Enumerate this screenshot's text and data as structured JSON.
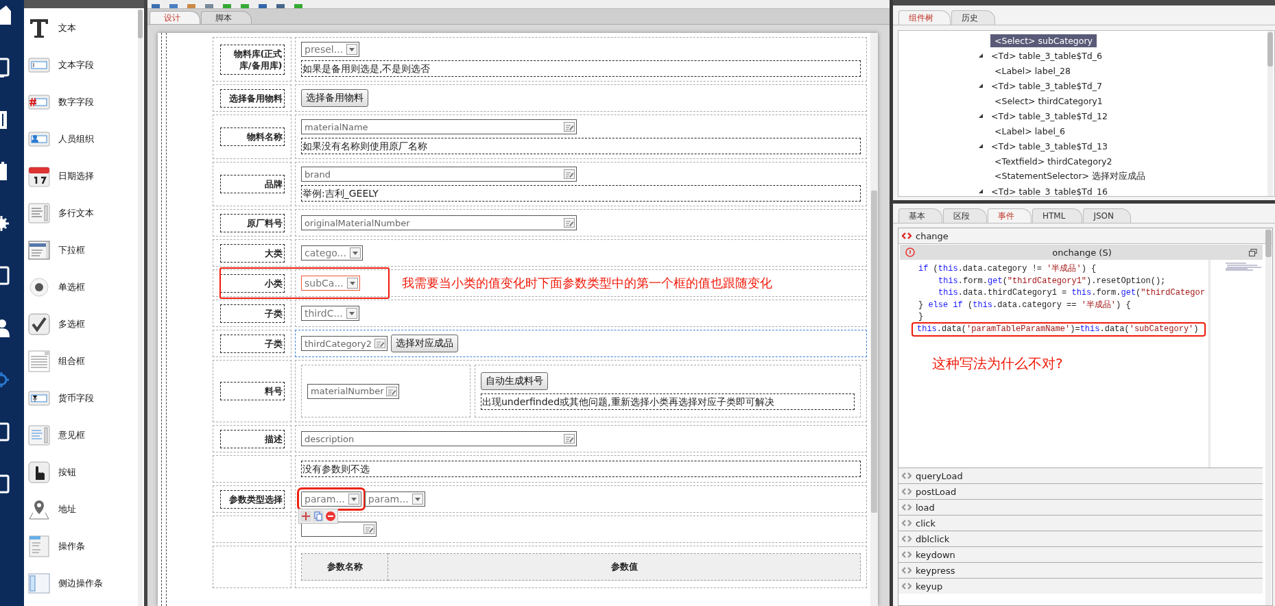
{
  "palette": {
    "items": [
      {
        "label": "文本"
      },
      {
        "label": "文本字段"
      },
      {
        "label": "数字字段"
      },
      {
        "label": "人员组织"
      },
      {
        "label": "日期选择"
      },
      {
        "label": "多行文本"
      },
      {
        "label": "下拉框"
      },
      {
        "label": "单选框"
      },
      {
        "label": "多选框"
      },
      {
        "label": "组合框"
      },
      {
        "label": "货币字段"
      },
      {
        "label": "意见框"
      },
      {
        "label": "按钮"
      },
      {
        "label": "地址"
      },
      {
        "label": "操作条"
      },
      {
        "label": "侧边操作条"
      }
    ]
  },
  "designer": {
    "tabs": [
      {
        "label": "设计",
        "selected": true
      },
      {
        "label": "脚本",
        "selected": false
      }
    ],
    "rows": [
      {
        "label": "物料库(正式库/备用库)",
        "selected": false,
        "highlighted": false,
        "items": [
          {
            "kind": "select",
            "value": "presel...",
            "highlighted": false,
            "framed": false
          },
          {
            "kind": "note",
            "text": "如果是备用则选是,不是则选否"
          }
        ]
      },
      {
        "label": "选择备用物料",
        "selected": false,
        "highlighted": false,
        "items": [
          {
            "kind": "button",
            "label": "选择备用物料"
          }
        ]
      },
      {
        "label": "物料名称",
        "selected": false,
        "highlighted": false,
        "items": [
          {
            "kind": "textfield",
            "value": "materialName",
            "wide": true
          },
          {
            "kind": "note",
            "text": "如果没有名称则使用原厂名称"
          }
        ]
      },
      {
        "label": "品牌",
        "selected": false,
        "highlighted": false,
        "items": [
          {
            "kind": "textfield",
            "value": "brand",
            "wide": true
          },
          {
            "kind": "note",
            "text": "举例:吉利_GEELY"
          }
        ]
      },
      {
        "label": "原厂料号",
        "selected": false,
        "highlighted": false,
        "items": [
          {
            "kind": "textfield",
            "value": "originalMaterialNumber",
            "wide": true
          }
        ]
      },
      {
        "label": "大类",
        "selected": false,
        "highlighted": false,
        "items": [
          {
            "kind": "select",
            "value": "catego...",
            "highlighted": false,
            "framed": false
          }
        ]
      },
      {
        "label": "小类",
        "selected": false,
        "highlighted": true,
        "items": [
          {
            "kind": "select",
            "value": "subCa...",
            "highlighted": true,
            "framed": false
          },
          {
            "kind": "annotation",
            "text": "我需要当小类的值变化时下面参数类型中的第一个框的值也跟随变化"
          }
        ]
      },
      {
        "label": "子类",
        "selected": false,
        "highlighted": false,
        "items": [
          {
            "kind": "select",
            "value": "thirdC...",
            "highlighted": false,
            "framed": false
          }
        ]
      },
      {
        "label": "子类",
        "selected": true,
        "highlighted": false,
        "items": [
          {
            "kind": "textfield",
            "value": "thirdCategory2",
            "wide": false
          },
          {
            "kind": "button",
            "label": "选择对应成品"
          }
        ]
      },
      {
        "label": "料号",
        "selected": false,
        "highlighted": false,
        "items": [
          {
            "kind": "nested",
            "columns": [
              [
                {
                  "kind": "textfield",
                  "value": "materialNumber",
                  "wide": false
                }
              ],
              [
                {
                  "kind": "button",
                  "label": "自动生成料号"
                },
                {
                  "kind": "note",
                  "text": "出现underfinded或其他问题,重新选择小类再选择对应子类即可解决"
                }
              ]
            ]
          }
        ]
      },
      {
        "label": "描述",
        "selected": false,
        "highlighted": false,
        "items": [
          {
            "kind": "textfield",
            "value": "description",
            "wide": true
          }
        ]
      },
      {
        "selected": false,
        "highlighted": false,
        "items": [
          {
            "kind": "note",
            "text": "没有参数则不选"
          }
        ]
      },
      {
        "label": "参数类型选择",
        "selected": false,
        "highlighted": false,
        "items": [
          {
            "kind": "select",
            "value": "param...",
            "highlighted": false,
            "framed": true
          },
          {
            "kind": "select",
            "value": "param...",
            "highlighted": false,
            "framed": false
          }
        ]
      },
      {
        "selected": false,
        "highlighted": false,
        "items": [
          {
            "kind": "textfield",
            "wide": false
          }
        ]
      },
      {
        "selected": false,
        "highlighted": false,
        "items": [
          {
            "kind": "table",
            "columns": [
              "参数名称",
              "参数值"
            ]
          }
        ]
      }
    ]
  },
  "component_tree": {
    "tabs": [
      {
        "label": "组件树",
        "selected": true
      },
      {
        "label": "历史",
        "selected": false
      }
    ],
    "continued_children": [
      {
        "text": "<Select> subCategory",
        "selected": true
      }
    ],
    "items": [
      {
        "text": "<Td> table_3_table$Td_6",
        "expanded": true,
        "selected": false,
        "children": [
          {
            "text": "<Label> label_28",
            "selected": false
          }
        ]
      },
      {
        "text": "<Td> table_3_table$Td_7",
        "expanded": true,
        "selected": false,
        "children": [
          {
            "text": "<Select> thirdCategory1",
            "selected": false
          }
        ]
      },
      {
        "text": "<Td> table_3_table$Td_12",
        "expanded": true,
        "selected": false,
        "children": [
          {
            "text": "<Label> label_6",
            "selected": false
          }
        ]
      },
      {
        "text": "<Td> table_3_table$Td_13",
        "expanded": true,
        "selected": false,
        "children": [
          {
            "text": "<Textfield> thirdCategory2",
            "selected": false
          },
          {
            "text": "<StatementSelector> 选择对应成品",
            "selected": false
          }
        ]
      },
      {
        "text": "<Td> table_3_table$Td_16",
        "expanded": true,
        "selected": false
      }
    ]
  },
  "properties": {
    "tabs": [
      {
        "label": "基本",
        "selected": false
      },
      {
        "label": "区段",
        "selected": false
      },
      {
        "label": "事件",
        "selected": true
      },
      {
        "label": "HTML",
        "selected": false
      },
      {
        "label": "JSON",
        "selected": false
      }
    ],
    "active_event": {
      "name": "change",
      "handler_title": "onchange (S)",
      "annotation": "这种写法为什么不对?",
      "code_lines": [
        {
          "highlighted": false,
          "indented": false,
          "tokens": [
            {
              "kind": "keyword",
              "text": "if"
            },
            {
              "kind": "plain",
              "text": " ("
            },
            {
              "kind": "keyword",
              "text": "this"
            },
            {
              "kind": "plain",
              "text": ".data.category != "
            },
            {
              "kind": "string",
              "text": "'半成品'"
            },
            {
              "kind": "plain",
              "text": ") {"
            }
          ]
        },
        {
          "highlighted": false,
          "indented": true,
          "tokens": [
            {
              "kind": "keyword",
              "text": "this"
            },
            {
              "kind": "plain",
              "text": ".form."
            },
            {
              "kind": "keyword",
              "text": "get"
            },
            {
              "kind": "plain",
              "text": "("
            },
            {
              "kind": "string",
              "text": "\"thirdCategory1\""
            },
            {
              "kind": "plain",
              "text": ").resetOption();"
            }
          ]
        },
        {
          "highlighted": false,
          "indented": true,
          "tokens": [
            {
              "kind": "keyword",
              "text": "this"
            },
            {
              "kind": "plain",
              "text": ".data.thirdCategory1 = "
            },
            {
              "kind": "keyword",
              "text": "this"
            },
            {
              "kind": "plain",
              "text": ".form."
            },
            {
              "kind": "keyword",
              "text": "get"
            },
            {
              "kind": "plain",
              "text": "("
            },
            {
              "kind": "string",
              "text": "\"thirdCategor"
            }
          ]
        },
        {
          "highlighted": false,
          "indented": false,
          "tokens": [
            {
              "kind": "plain",
              "text": "} "
            },
            {
              "kind": "keyword",
              "text": "else if"
            },
            {
              "kind": "plain",
              "text": " ("
            },
            {
              "kind": "keyword",
              "text": "this"
            },
            {
              "kind": "plain",
              "text": ".data.category == "
            },
            {
              "kind": "string",
              "text": "'半成品'"
            },
            {
              "kind": "plain",
              "text": ") {"
            }
          ]
        },
        {
          "highlighted": false,
          "indented": false,
          "tokens": [
            {
              "kind": "plain",
              "text": "}"
            }
          ]
        },
        {
          "highlighted": true,
          "indented": false,
          "tokens": [
            {
              "kind": "keyword",
              "text": "this"
            },
            {
              "kind": "plain",
              "text": ".data("
            },
            {
              "kind": "string",
              "text": "'paramTableParamName'"
            },
            {
              "kind": "plain",
              "text": ")="
            },
            {
              "kind": "keyword",
              "text": "this"
            },
            {
              "kind": "plain",
              "text": ".data("
            },
            {
              "kind": "string",
              "text": "'subCategory'"
            },
            {
              "kind": "plain",
              "text": ")"
            }
          ]
        }
      ]
    },
    "event_list": [
      "queryLoad",
      "postLoad",
      "load",
      "click",
      "dblclick",
      "keydown",
      "keypress",
      "keyup"
    ]
  }
}
